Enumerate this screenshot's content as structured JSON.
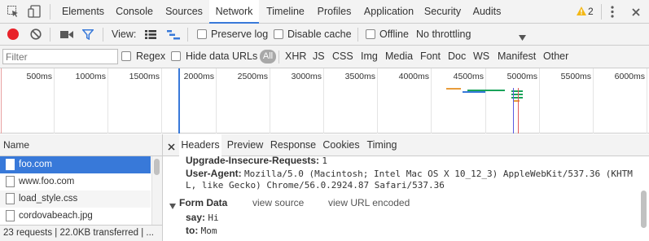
{
  "tabs": [
    "Elements",
    "Console",
    "Sources",
    "Network",
    "Timeline",
    "Profiles",
    "Application",
    "Security",
    "Audits"
  ],
  "active_tab": "Network",
  "warnings_count": "2",
  "toolbar": {
    "view_label": "View:",
    "preserve_log": "Preserve log",
    "disable_cache": "Disable cache",
    "offline": "Offline",
    "throttling": "No throttling"
  },
  "filter": {
    "placeholder": "Filter",
    "regex": "Regex",
    "hide_data_urls": "Hide data URLs",
    "types": [
      "All",
      "XHR",
      "JS",
      "CSS",
      "Img",
      "Media",
      "Font",
      "Doc",
      "WS",
      "Manifest",
      "Other"
    ]
  },
  "timeline_ticks": [
    "500ms",
    "1000ms",
    "1500ms",
    "2000ms",
    "2500ms",
    "3000ms",
    "3500ms",
    "4000ms",
    "4500ms",
    "5000ms",
    "5500ms",
    "6000ms"
  ],
  "requests": {
    "header": "Name",
    "items": [
      "foo.com",
      "www.foo.com",
      "load_style.css",
      "cordovabeach.jpg"
    ],
    "selected": 0,
    "status": "23 requests | 22.0KB transferred | ..."
  },
  "detail": {
    "tabs": [
      "Headers",
      "Preview",
      "Response",
      "Cookies",
      "Timing"
    ],
    "active_tab": "Headers",
    "headers": [
      {
        "name": "Upgrade-Insecure-Requests:",
        "value": "1"
      },
      {
        "name": "User-Agent:",
        "value": "Mozilla/5.0 (Macintosh; Intel Mac OS X 10_12_3) AppleWebKit/537.36 (KHTM",
        "value2": "L, like Gecko) Chrome/56.0.2924.87 Safari/537.36"
      }
    ],
    "form_data": {
      "title": "Form Data",
      "view_source": "view source",
      "view_url_encoded": "view URL encoded",
      "fields": [
        {
          "name": "say:",
          "value": "Hi"
        },
        {
          "name": "to:",
          "value": "Mom"
        }
      ]
    }
  },
  "colors": {
    "accent": "#3879d9",
    "record": "#e8222a",
    "selected_row": "#3879d9"
  }
}
